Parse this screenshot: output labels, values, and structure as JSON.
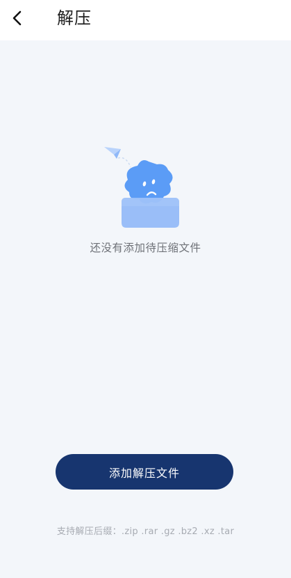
{
  "header": {
    "back_icon": "chevron-left-icon",
    "title": "解压"
  },
  "empty_state": {
    "illustration_icon": "empty-folder-star-icon",
    "message": "还没有添加待压缩文件"
  },
  "actions": {
    "add_button_label": "添加解压文件"
  },
  "footer": {
    "supported_formats_text": "支持解压后缀：.zip .rar .gz .bz2 .xz .tar"
  },
  "colors": {
    "accent": "#17356f",
    "background": "#f3f6fa",
    "illustration_blue": "#5b9cf6"
  }
}
